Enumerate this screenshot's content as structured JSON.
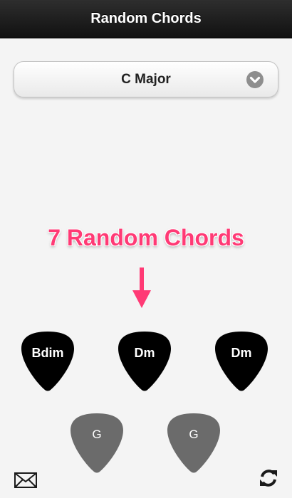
{
  "navbar": {
    "title": "Random Chords"
  },
  "selector": {
    "value": "C Major",
    "icon": "chevron-down-icon"
  },
  "banner": {
    "text": "7 Random Chords"
  },
  "colors": {
    "accent": "#ff3a75",
    "pick_dark": "#000000",
    "pick_gray": "#6b6b6b"
  },
  "picks": [
    {
      "label": "Bdim",
      "style": "dark"
    },
    {
      "label": "Dm",
      "style": "dark"
    },
    {
      "label": "Dm",
      "style": "dark"
    },
    {
      "label": "G",
      "style": "gray"
    },
    {
      "label": "G",
      "style": "gray"
    }
  ],
  "toolbar": {
    "left_icon": "mail-icon",
    "right_icon": "refresh-icon"
  }
}
